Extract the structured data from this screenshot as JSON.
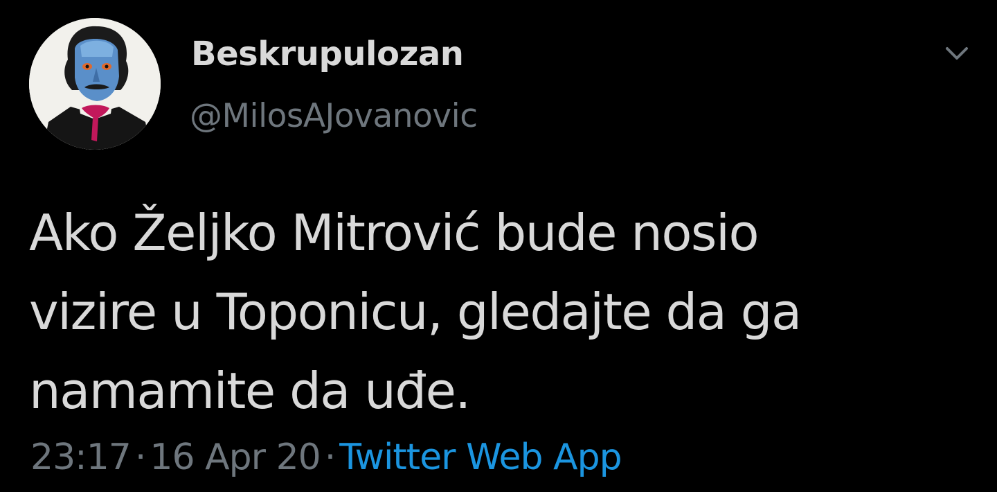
{
  "author": {
    "display_name": "Beskrupulozan",
    "handle": "@MilosAJovanovic",
    "avatar_icon": "portrait-avatar-icon"
  },
  "menu": {
    "icon": "chevron-down-icon"
  },
  "tweet": {
    "text": "Ako Željko Mitrović bude nosio\nvizire u Toponicu, gledajte da ga\nnamamite da uđe."
  },
  "meta": {
    "time": "23:17",
    "separator": "·",
    "date": "16 Apr 20",
    "source": "Twitter Web App"
  },
  "colors": {
    "background": "#000000",
    "text": "#d9d9d9",
    "secondary": "#6e767d",
    "link": "#1b95e0"
  }
}
